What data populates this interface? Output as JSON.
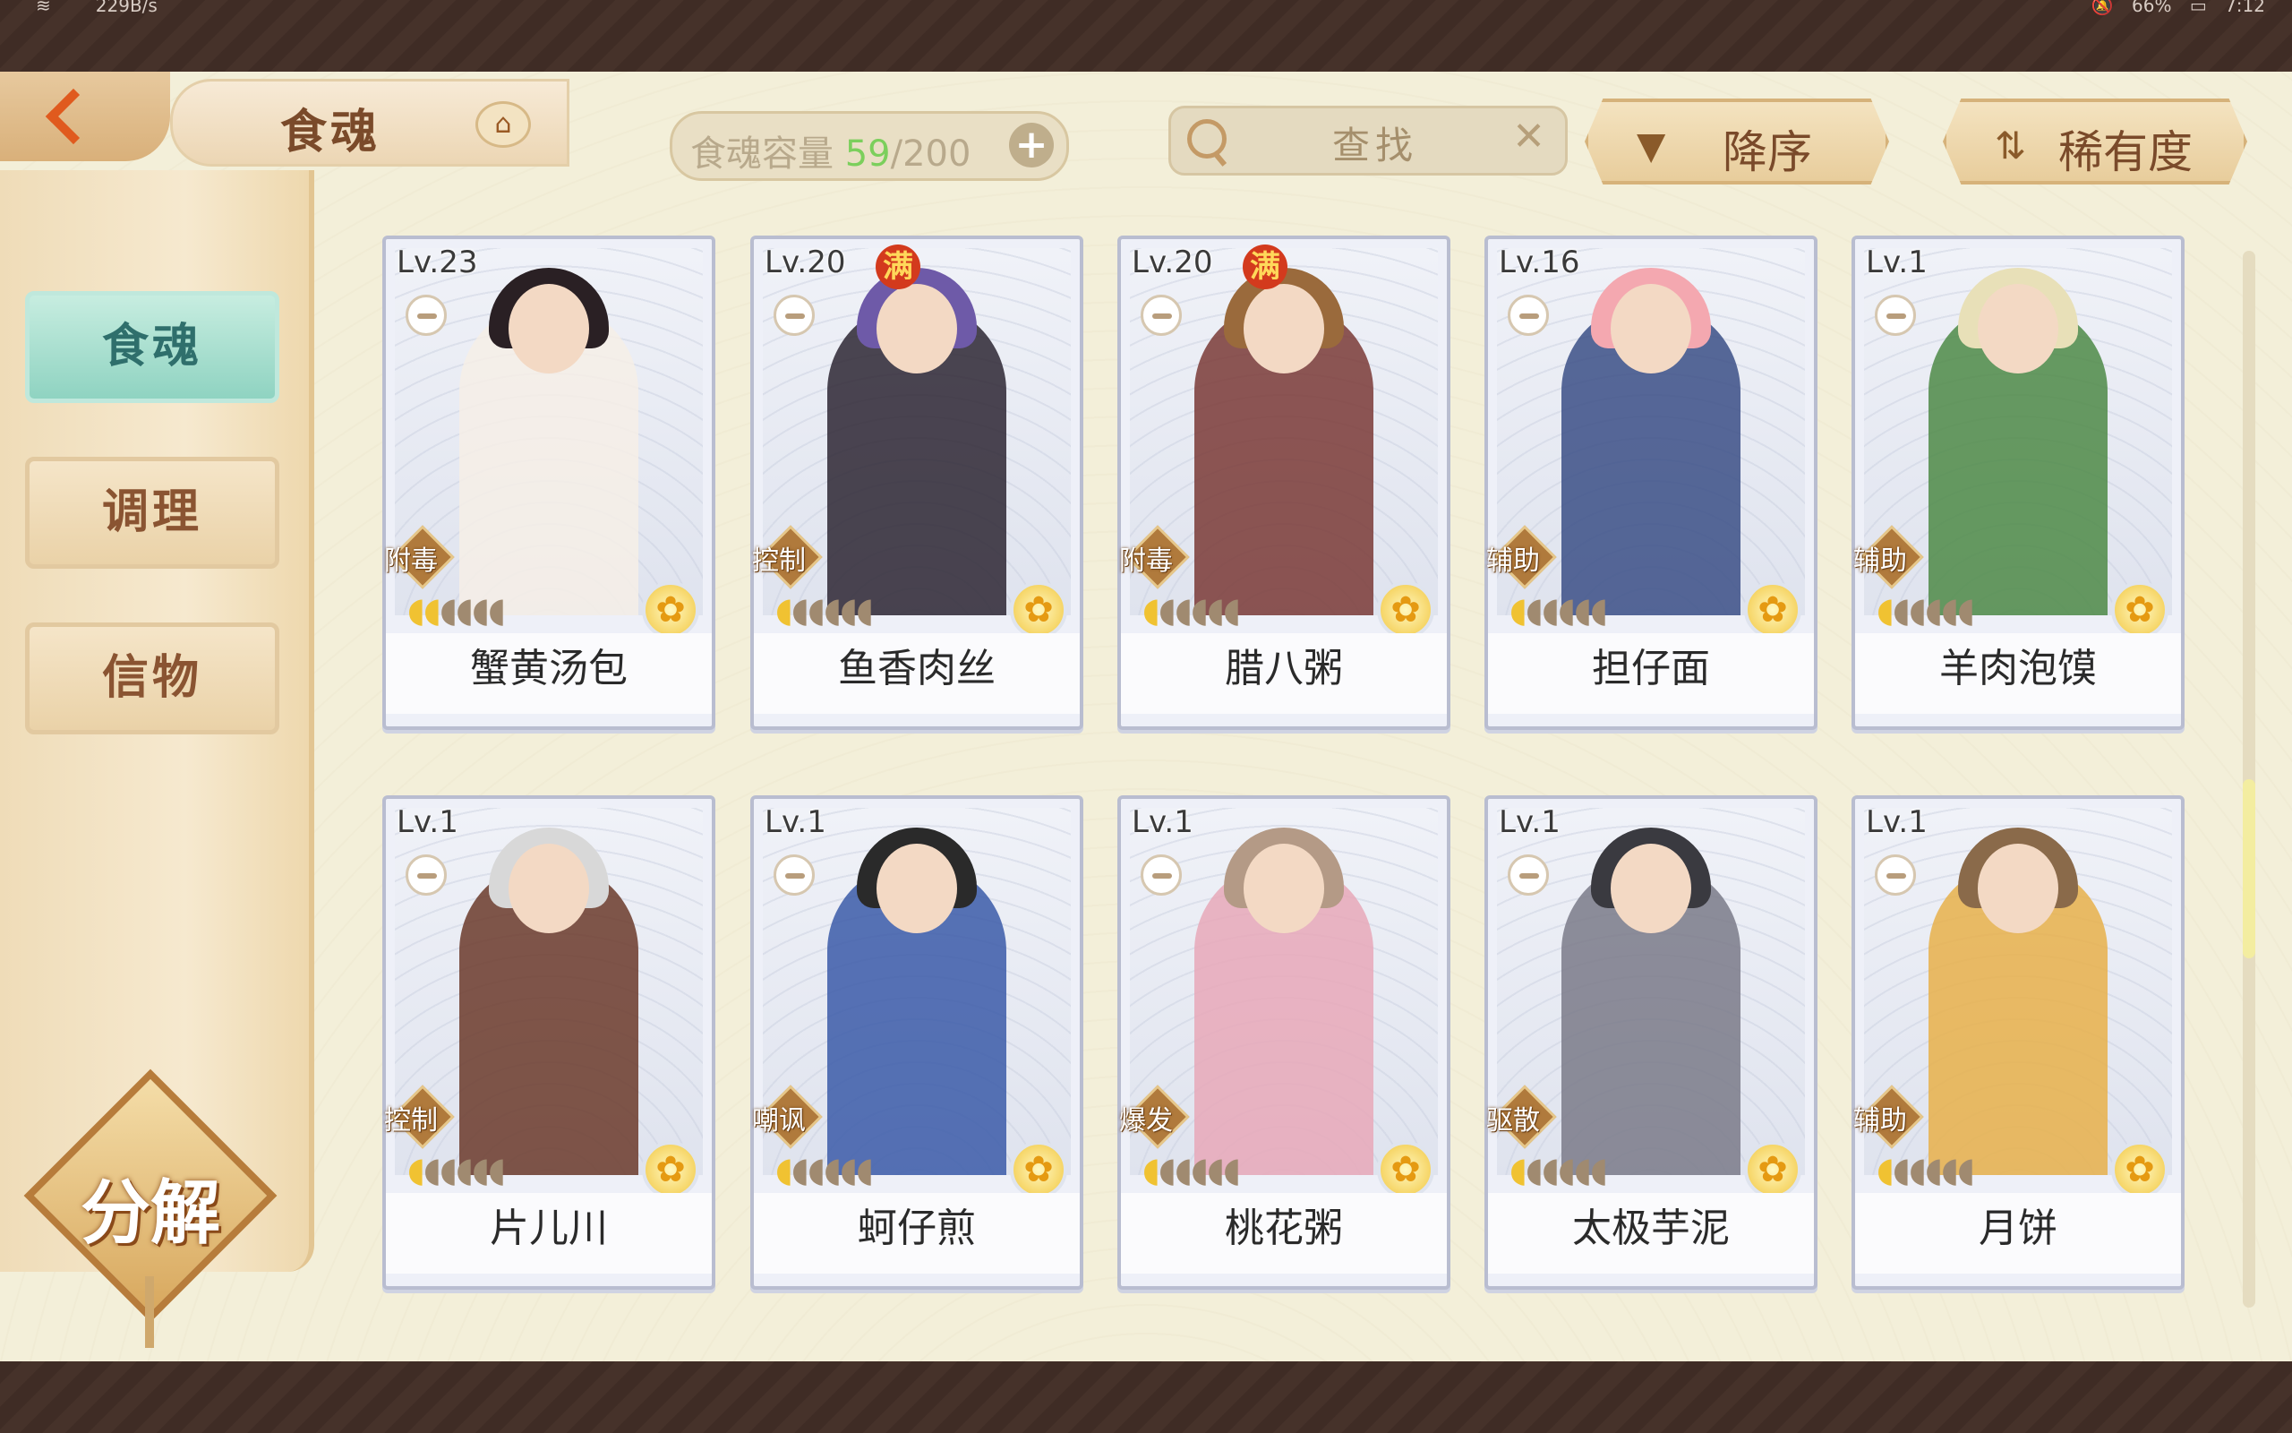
{
  "status": {
    "network_speed": "229B/s",
    "battery": "66%",
    "time": "7:12"
  },
  "header": {
    "title": "食魂",
    "capacity_label": "食魂容量",
    "capacity_used": "59",
    "capacity_total": "/200",
    "search_label": "查找",
    "sort_order_label": "降序",
    "sort_key_label": "稀有度"
  },
  "sidebar": {
    "tabs": [
      {
        "label": "食魂",
        "active": true
      },
      {
        "label": "调理",
        "active": false
      },
      {
        "label": "信物",
        "active": false
      }
    ],
    "decompose_label": "分解"
  },
  "cards": [
    {
      "level": "Lv.23",
      "full": "",
      "role": "附毒",
      "name": "蟹黄汤包",
      "stars_on": 2,
      "stars_total": 6,
      "hair": "#2a2024",
      "outfit": "#f6efe6"
    },
    {
      "level": "Lv.20",
      "full": "满",
      "role": "控制",
      "name": "鱼香肉丝",
      "stars_on": 1,
      "stars_total": 6,
      "hair": "#6e5aa8",
      "outfit": "#2d2633"
    },
    {
      "level": "Lv.20",
      "full": "满",
      "role": "附毒",
      "name": "腊八粥",
      "stars_on": 1,
      "stars_total": 6,
      "hair": "#9a6a3c",
      "outfit": "#7a3a36"
    },
    {
      "level": "Lv.16",
      "full": "",
      "role": "辅助",
      "name": "担仔面",
      "stars_on": 1,
      "stars_total": 6,
      "hair": "#f4a8b0",
      "outfit": "#3b4f86"
    },
    {
      "level": "Lv.1",
      "full": "",
      "role": "辅助",
      "name": "羊肉泡馍",
      "stars_on": 1,
      "stars_total": 6,
      "hair": "#e8e0b8",
      "outfit": "#4d8a47"
    },
    {
      "level": "Lv.1",
      "full": "",
      "role": "控制",
      "name": "片儿川",
      "stars_on": 1,
      "stars_total": 6,
      "hair": "#d8d8d8",
      "outfit": "#6b3a2a"
    },
    {
      "level": "Lv.1",
      "full": "",
      "role": "嘲讽",
      "name": "蚵仔煎",
      "stars_on": 1,
      "stars_total": 6,
      "hair": "#2a2a2a",
      "outfit": "#3b5aa8"
    },
    {
      "level": "Lv.1",
      "full": "",
      "role": "爆发",
      "name": "桃花粥",
      "stars_on": 1,
      "stars_total": 6,
      "hair": "#b49a86",
      "outfit": "#e8a8b8"
    },
    {
      "level": "Lv.1",
      "full": "",
      "role": "驱散",
      "name": "太极芋泥",
      "stars_on": 1,
      "stars_total": 6,
      "hair": "#3a3a40",
      "outfit": "#7a7a88"
    },
    {
      "level": "Lv.1",
      "full": "",
      "role": "辅助",
      "name": "月饼",
      "stars_on": 1,
      "stars_total": 6,
      "hair": "#8a6a4a",
      "outfit": "#e7b04a"
    }
  ],
  "colors": {
    "accent": "#e05a1e",
    "active_tab": "#8fd3c1",
    "capacity_used": "#7bcf5c",
    "star_on": "#f0c232"
  }
}
